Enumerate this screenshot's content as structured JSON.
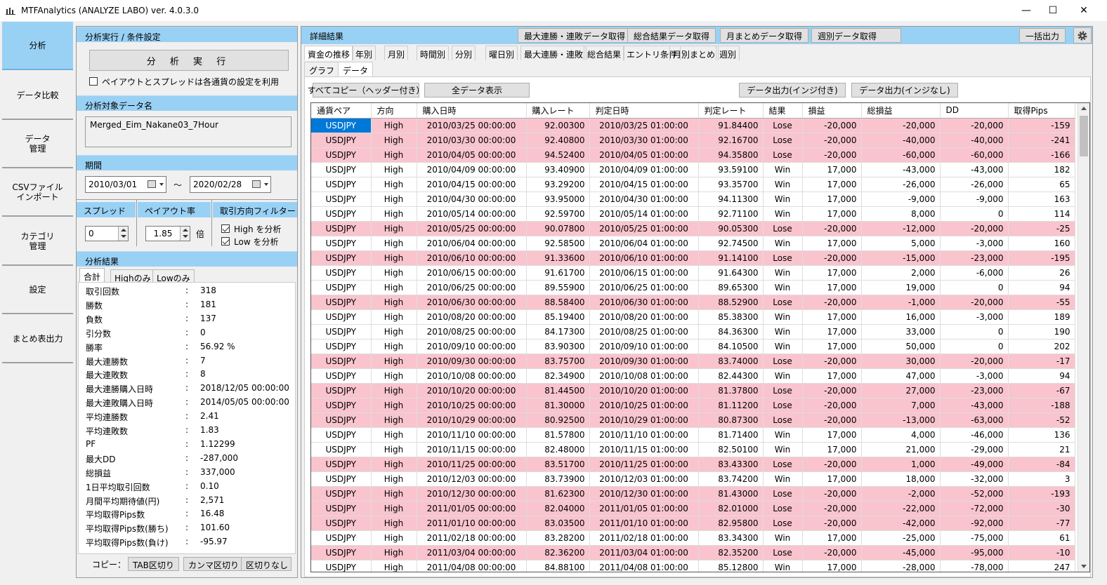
{
  "window": {
    "title": "MTFAnalytics (ANALYZE LABO)   ver. 4.0.3.0",
    "minimize": "—",
    "maximize": "☐",
    "close": "✕"
  },
  "nav": [
    {
      "line1": "分析",
      "line2": ""
    },
    {
      "line1": "データ比較",
      "line2": ""
    },
    {
      "line1": "データ",
      "line2": "管理"
    },
    {
      "line1": "CSVファイル",
      "line2": "インポート"
    },
    {
      "line1": "カテゴリ",
      "line2": "管理"
    },
    {
      "line1": "設定",
      "line2": ""
    },
    {
      "line1": "まとめ表出力",
      "line2": ""
    }
  ],
  "cond": {
    "head": "分析実行 / 条件設定",
    "run": "分 析 実 行",
    "use_pair_settings": "ペイアウトとスプレッドは各通貨の設定を利用",
    "target_head": "分析対象データ名",
    "target_value": "Merged_Eim_Nakane03_7Hour",
    "period_head": "期間",
    "date_from": "2010/03/01",
    "tilde": "～",
    "date_to": "2020/02/28",
    "spread_head": "スプレッド",
    "spread_value": "0",
    "payout_head": "ペイアウト率",
    "payout_value": "1.85",
    "payout_unit": "倍",
    "filter_head": "取引方向フィルター",
    "high_label": "High を分析",
    "low_label": "Low を分析"
  },
  "result": {
    "head": "分析結果",
    "tabs": [
      "合計",
      "Highのみ",
      "Lowのみ"
    ],
    "stats": [
      {
        "k": "取引回数",
        "v": "318"
      },
      {
        "k": "勝数",
        "v": "181"
      },
      {
        "k": "負数",
        "v": "137"
      },
      {
        "k": "引分数",
        "v": "0"
      },
      {
        "k": "勝率",
        "v": "56.92 %"
      },
      {
        "k": "最大連勝数",
        "v": "7"
      },
      {
        "k": "最大連敗数",
        "v": "8"
      },
      {
        "k": "最大連勝購入日時",
        "v": "2018/12/05 00:00:00"
      },
      {
        "k": "最大連敗購入日時",
        "v": "2014/05/05 00:00:00"
      },
      {
        "k": "平均連勝数",
        "v": "2.41"
      },
      {
        "k": "平均連敗数",
        "v": "1.83"
      },
      {
        "k": "PF",
        "v": "1.12299"
      },
      {
        "k": "最大DD",
        "v": "-287,000"
      },
      {
        "k": "総損益",
        "v": "337,000"
      },
      {
        "k": "1日平均取引回数",
        "v": "0.10"
      },
      {
        "k": "月間平均期待値(円)",
        "v": "2,571"
      },
      {
        "k": "平均取得Pips数",
        "v": "16.48"
      },
      {
        "k": "平均取得Pips数(勝ち)",
        "v": "101.60"
      },
      {
        "k": "平均取得Pips数(負け)",
        "v": "-95.97"
      }
    ],
    "colon": ":",
    "copy_label": "コピー：",
    "copy_tab": "TAB区切り",
    "copy_comma": "カンマ区切り",
    "copy_none": "区切りなし"
  },
  "detail": {
    "head": "詳細結果",
    "btn_streak": "最大連勝・連敗データ取得",
    "btn_total": "総合結果データ取得",
    "btn_month": "月まとめデータ取得",
    "btn_week": "週別データ取得",
    "btn_export_all": "一括出力",
    "tabs": [
      "資金の推移",
      "年別",
      "月別",
      "時間別",
      "分別",
      "曜日別",
      "最大連勝・連敗",
      "総合結果",
      "エントリ条件",
      "月別まとめ",
      "週別"
    ],
    "subtabs": [
      "グラフ",
      "データ"
    ],
    "btn_copy_all": "すべてコピー（ヘッダー付き）",
    "btn_show_all": "全データ表示",
    "btn_out_ind": "データ出力(インジ付き)",
    "btn_out_noind": "データ出力(インジなし)"
  },
  "table": {
    "columns": [
      "通貨ペア",
      "方向",
      "購入日時",
      "購入レート",
      "判定日時",
      "判定レート",
      "結果",
      "損益",
      "総損益",
      "DD",
      "取得Pips"
    ],
    "rows": [
      [
        "USDJPY",
        "High",
        "2010/03/25 00:00:00",
        "92.00300",
        "2010/03/25 01:00:00",
        "91.84400",
        "Lose",
        "-20,000",
        "-20,000",
        "-20,000",
        "-159"
      ],
      [
        "USDJPY",
        "High",
        "2010/03/30 00:00:00",
        "92.40800",
        "2010/03/30 01:00:00",
        "92.16700",
        "Lose",
        "-20,000",
        "-40,000",
        "-40,000",
        "-241"
      ],
      [
        "USDJPY",
        "High",
        "2010/04/05 00:00:00",
        "94.52400",
        "2010/04/05 01:00:00",
        "94.35800",
        "Lose",
        "-20,000",
        "-60,000",
        "-60,000",
        "-166"
      ],
      [
        "USDJPY",
        "High",
        "2010/04/09 00:00:00",
        "93.40900",
        "2010/04/09 01:00:00",
        "93.59100",
        "Win",
        "17,000",
        "-43,000",
        "-43,000",
        "182"
      ],
      [
        "USDJPY",
        "High",
        "2010/04/15 00:00:00",
        "93.29200",
        "2010/04/15 01:00:00",
        "93.35700",
        "Win",
        "17,000",
        "-26,000",
        "-26,000",
        "65"
      ],
      [
        "USDJPY",
        "High",
        "2010/04/30 00:00:00",
        "93.95000",
        "2010/04/30 01:00:00",
        "94.11300",
        "Win",
        "17,000",
        "-9,000",
        "-9,000",
        "163"
      ],
      [
        "USDJPY",
        "High",
        "2010/05/14 00:00:00",
        "92.59700",
        "2010/05/14 01:00:00",
        "92.71100",
        "Win",
        "17,000",
        "8,000",
        "0",
        "114"
      ],
      [
        "USDJPY",
        "High",
        "2010/05/25 00:00:00",
        "90.07800",
        "2010/05/25 01:00:00",
        "90.05300",
        "Lose",
        "-20,000",
        "-12,000",
        "-20,000",
        "-25"
      ],
      [
        "USDJPY",
        "High",
        "2010/06/04 00:00:00",
        "92.58500",
        "2010/06/04 01:00:00",
        "92.74500",
        "Win",
        "17,000",
        "5,000",
        "-3,000",
        "160"
      ],
      [
        "USDJPY",
        "High",
        "2010/06/10 00:00:00",
        "91.33600",
        "2010/06/10 01:00:00",
        "91.14100",
        "Lose",
        "-20,000",
        "-15,000",
        "-23,000",
        "-195"
      ],
      [
        "USDJPY",
        "High",
        "2010/06/15 00:00:00",
        "91.61700",
        "2010/06/15 01:00:00",
        "91.64300",
        "Win",
        "17,000",
        "2,000",
        "-6,000",
        "26"
      ],
      [
        "USDJPY",
        "High",
        "2010/06/25 00:00:00",
        "89.55900",
        "2010/06/25 01:00:00",
        "89.65300",
        "Win",
        "17,000",
        "19,000",
        "0",
        "94"
      ],
      [
        "USDJPY",
        "High",
        "2010/06/30 00:00:00",
        "88.58400",
        "2010/06/30 01:00:00",
        "88.52900",
        "Lose",
        "-20,000",
        "-1,000",
        "-20,000",
        "-55"
      ],
      [
        "USDJPY",
        "High",
        "2010/08/20 00:00:00",
        "85.19400",
        "2010/08/20 01:00:00",
        "85.38300",
        "Win",
        "17,000",
        "16,000",
        "-3,000",
        "189"
      ],
      [
        "USDJPY",
        "High",
        "2010/08/25 00:00:00",
        "84.17300",
        "2010/08/25 01:00:00",
        "84.36300",
        "Win",
        "17,000",
        "33,000",
        "0",
        "190"
      ],
      [
        "USDJPY",
        "High",
        "2010/09/10 00:00:00",
        "83.90300",
        "2010/09/10 01:00:00",
        "84.10500",
        "Win",
        "17,000",
        "50,000",
        "0",
        "202"
      ],
      [
        "USDJPY",
        "High",
        "2010/09/30 00:00:00",
        "83.75700",
        "2010/09/30 01:00:00",
        "83.74000",
        "Lose",
        "-20,000",
        "30,000",
        "-20,000",
        "-17"
      ],
      [
        "USDJPY",
        "High",
        "2010/10/08 00:00:00",
        "82.34900",
        "2010/10/08 01:00:00",
        "82.44300",
        "Win",
        "17,000",
        "47,000",
        "-3,000",
        "94"
      ],
      [
        "USDJPY",
        "High",
        "2010/10/20 00:00:00",
        "81.44500",
        "2010/10/20 01:00:00",
        "81.37800",
        "Lose",
        "-20,000",
        "27,000",
        "-23,000",
        "-67"
      ],
      [
        "USDJPY",
        "High",
        "2010/10/25 00:00:00",
        "81.30000",
        "2010/10/25 01:00:00",
        "81.11200",
        "Lose",
        "-20,000",
        "7,000",
        "-43,000",
        "-188"
      ],
      [
        "USDJPY",
        "High",
        "2010/10/29 00:00:00",
        "80.92500",
        "2010/10/29 01:00:00",
        "80.87300",
        "Lose",
        "-20,000",
        "-13,000",
        "-63,000",
        "-52"
      ],
      [
        "USDJPY",
        "High",
        "2010/11/10 00:00:00",
        "81.57800",
        "2010/11/10 01:00:00",
        "81.71400",
        "Win",
        "17,000",
        "4,000",
        "-46,000",
        "136"
      ],
      [
        "USDJPY",
        "High",
        "2010/11/15 00:00:00",
        "82.48000",
        "2010/11/15 01:00:00",
        "82.50100",
        "Win",
        "17,000",
        "21,000",
        "-29,000",
        "21"
      ],
      [
        "USDJPY",
        "High",
        "2010/11/25 00:00:00",
        "83.51700",
        "2010/11/25 01:00:00",
        "83.43300",
        "Lose",
        "-20,000",
        "1,000",
        "-49,000",
        "-84"
      ],
      [
        "USDJPY",
        "High",
        "2010/12/03 00:00:00",
        "83.73900",
        "2010/12/03 01:00:00",
        "83.74200",
        "Win",
        "17,000",
        "18,000",
        "-32,000",
        "3"
      ],
      [
        "USDJPY",
        "High",
        "2010/12/30 00:00:00",
        "81.62300",
        "2010/12/30 01:00:00",
        "81.43000",
        "Lose",
        "-20,000",
        "-2,000",
        "-52,000",
        "-193"
      ],
      [
        "USDJPY",
        "High",
        "2011/01/05 00:00:00",
        "82.04000",
        "2011/01/05 01:00:00",
        "82.01000",
        "Lose",
        "-20,000",
        "-22,000",
        "-72,000",
        "-30"
      ],
      [
        "USDJPY",
        "High",
        "2011/01/10 00:00:00",
        "83.03500",
        "2011/01/10 01:00:00",
        "82.95800",
        "Lose",
        "-20,000",
        "-42,000",
        "-92,000",
        "-77"
      ],
      [
        "USDJPY",
        "High",
        "2011/02/18 00:00:00",
        "83.28200",
        "2011/02/18 01:00:00",
        "83.34300",
        "Win",
        "17,000",
        "-25,000",
        "-75,000",
        "61"
      ],
      [
        "USDJPY",
        "High",
        "2011/03/04 00:00:00",
        "82.36200",
        "2011/03/04 01:00:00",
        "82.35200",
        "Lose",
        "-20,000",
        "-45,000",
        "-95,000",
        "-10"
      ],
      [
        "USDJPY",
        "High",
        "2011/04/08 00:00:00",
        "84.88100",
        "2011/04/08 01:00:00",
        "85.12800",
        "Win",
        "17,000",
        "-28,000",
        "-78,000",
        "247"
      ]
    ]
  },
  "colors": {
    "accent": "#99d1f5",
    "lose_row": "#f9c4cd",
    "selection": "#0078d7"
  }
}
